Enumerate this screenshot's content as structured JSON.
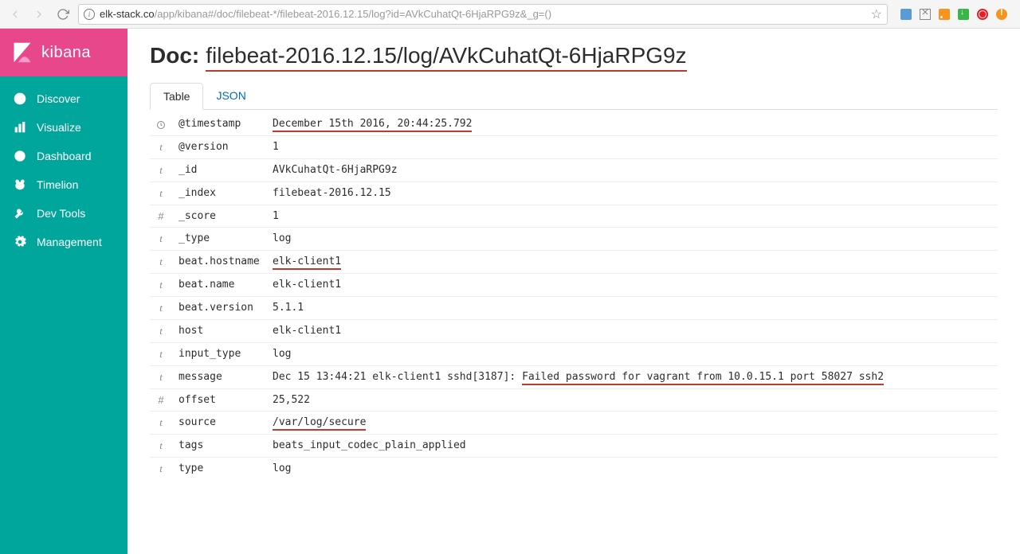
{
  "browser": {
    "url_host": "elk-stack.co",
    "url_path": "/app/kibana#/doc/filebeat-*/filebeat-2016.12.15/log?id=AVkCuhatQt-6HjaRPG9z&_g=()"
  },
  "logo": {
    "text": "kibana"
  },
  "sidebar": {
    "items": [
      {
        "label": "Discover",
        "icon": "compass-icon"
      },
      {
        "label": "Visualize",
        "icon": "bar-chart-icon"
      },
      {
        "label": "Dashboard",
        "icon": "gauge-icon"
      },
      {
        "label": "Timelion",
        "icon": "bear-icon"
      },
      {
        "label": "Dev Tools",
        "icon": "wrench-icon"
      },
      {
        "label": "Management",
        "icon": "gear-icon"
      }
    ]
  },
  "doc": {
    "prefix": "Doc:",
    "path": "filebeat-2016.12.15/log/AVkCuhatQt-6HjaRPG9z"
  },
  "tabs": [
    {
      "label": "Table",
      "active": true
    },
    {
      "label": "JSON",
      "active": false
    }
  ],
  "fields": [
    {
      "type": "clock",
      "name": "@timestamp",
      "value": "December 15th 2016, 20:44:25.792",
      "underline": "full"
    },
    {
      "type": "t",
      "name": "@version",
      "value": "1"
    },
    {
      "type": "t",
      "name": "_id",
      "value": "AVkCuhatQt-6HjaRPG9z"
    },
    {
      "type": "t",
      "name": "_index",
      "value": "filebeat-2016.12.15"
    },
    {
      "type": "#",
      "name": "_score",
      "value": "1"
    },
    {
      "type": "t",
      "name": "_type",
      "value": "log"
    },
    {
      "type": "t",
      "name": "beat.hostname",
      "value": "elk-client1",
      "underline": "full"
    },
    {
      "type": "t",
      "name": "beat.name",
      "value": "elk-client1"
    },
    {
      "type": "t",
      "name": "beat.version",
      "value": "5.1.1"
    },
    {
      "type": "t",
      "name": "host",
      "value": "elk-client1"
    },
    {
      "type": "t",
      "name": "input_type",
      "value": "log"
    },
    {
      "type": "t",
      "name": "message",
      "value_pre": "Dec 15 13:44:21 elk-client1 sshd[3187]: ",
      "value_underlined": "Failed password for vagrant from 10.0.15.1 port 58027 ssh2",
      "underline": "partial"
    },
    {
      "type": "#",
      "name": "offset",
      "value": "25,522"
    },
    {
      "type": "t",
      "name": "source",
      "value": "/var/log/secure",
      "underline": "full"
    },
    {
      "type": "t",
      "name": "tags",
      "value": "beats_input_codec_plain_applied"
    },
    {
      "type": "t",
      "name": "type",
      "value": "log"
    }
  ]
}
